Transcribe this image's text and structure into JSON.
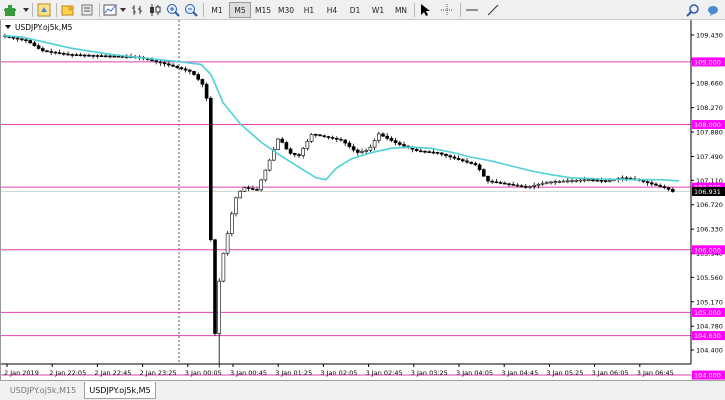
{
  "toolbar": {
    "timeframes": [
      "M1",
      "M5",
      "M15",
      "M30",
      "H1",
      "H4",
      "D1",
      "W1",
      "MN"
    ],
    "active_timeframe": "M5"
  },
  "chart": {
    "symbol_label": "USDJPY.oj5k,M5",
    "colors": {
      "ma_line": "#4fd1d9",
      "level_line": "#e040b0",
      "candle": "#000000",
      "price_label_bg": "#ff00ff",
      "current_price_bg": "#000000"
    },
    "price_axis_ticks": [
      "109.430",
      "109.040",
      "108.660",
      "108.270",
      "107.880",
      "107.490",
      "107.110",
      "106.720",
      "106.330",
      "105.940",
      "105.560",
      "105.170",
      "104.780",
      "104.400"
    ],
    "time_axis_ticks": [
      "2 Jan 2019",
      "2 Jan 22:05",
      "2 Jan 22:45",
      "2 Jan 23:25",
      "3 Jan 00:05",
      "3 Jan 00:45",
      "3 Jan 01:25",
      "3 Jan 02:05",
      "3 Jan 02:45",
      "3 Jan 03:25",
      "3 Jan 04:05",
      "3 Jan 04:45",
      "3 Jan 05:25",
      "3 Jan 06:05",
      "3 Jan 06:45"
    ],
    "levels": [
      {
        "price": 109.0,
        "label": "109.000"
      },
      {
        "price": 108.0,
        "label": "108.000"
      },
      {
        "price": 107.0,
        "label": "107.000"
      },
      {
        "price": 106.0,
        "label": "106.000"
      },
      {
        "price": 105.0,
        "label": "105.000"
      },
      {
        "price": 104.63,
        "label": "104.630"
      },
      {
        "price": 104.0,
        "label": "104.000"
      }
    ],
    "current_price": {
      "price": 106.931,
      "label": "106.931"
    }
  },
  "tabs": [
    {
      "label": "USDJPY.oj5k,M15",
      "active": false
    },
    {
      "label": "USDJPY.oj5k,M5",
      "active": true
    }
  ]
}
